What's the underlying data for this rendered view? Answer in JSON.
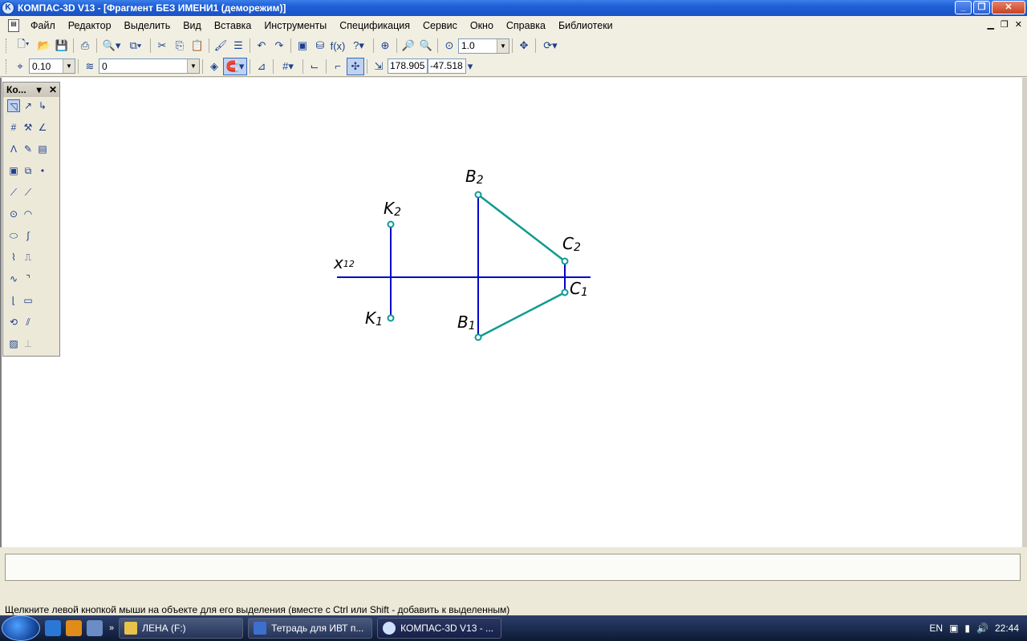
{
  "window": {
    "title": "КОМПАС-3D V13 - [Фрагмент БЕЗ ИМЕНИ1 (деморежим)]",
    "app_icon": "kompas-logo-icon"
  },
  "menu": {
    "items": [
      "Файл",
      "Редактор",
      "Выделить",
      "Вид",
      "Вставка",
      "Инструменты",
      "Спецификация",
      "Сервис",
      "Окно",
      "Справка",
      "Библиотеки"
    ]
  },
  "toolbar1": {
    "zoom_value": "1.0"
  },
  "toolbar2": {
    "step_value": "0.10",
    "layer_value": "0",
    "coord_x": "178.905",
    "coord_y": "-47.518"
  },
  "panel": {
    "title": "Ко..."
  },
  "drawing": {
    "axis_label": "x",
    "axis_subscript": "12",
    "points": [
      {
        "id": "K2",
        "letter": "K",
        "sub": "2"
      },
      {
        "id": "K1",
        "letter": "K",
        "sub": "1"
      },
      {
        "id": "B2",
        "letter": "B",
        "sub": "2"
      },
      {
        "id": "B1",
        "letter": "B",
        "sub": "1"
      },
      {
        "id": "C2",
        "letter": "C",
        "sub": "2"
      },
      {
        "id": "C1",
        "letter": "C",
        "sub": "1"
      }
    ],
    "colors": {
      "blue_line": "#0000cc",
      "teal_line": "#0f9b8e",
      "label": "#000000"
    }
  },
  "status": {
    "message": "Щелкните левой кнопкой мыши на объекте для его выделения (вместе с Ctrl или Shift - добавить к выделенным)"
  },
  "taskbar": {
    "tasks": [
      {
        "label": "ЛЕНА (F:)",
        "icon": "folder-icon"
      },
      {
        "label": "Тетрадь для ИВТ п...",
        "icon": "word-icon"
      },
      {
        "label": "КОМПАС-3D V13 - ...",
        "icon": "kompas-icon"
      }
    ],
    "lang": "EN",
    "time": "22:44"
  }
}
